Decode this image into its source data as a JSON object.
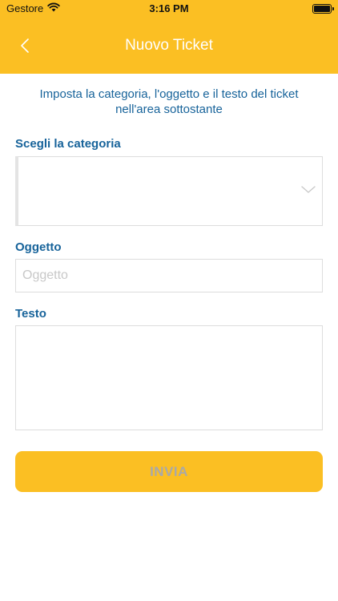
{
  "status_bar": {
    "carrier": "Gestore",
    "time": "3:16 PM"
  },
  "nav": {
    "title": "Nuovo Ticket",
    "back_icon": "chevron-left-icon"
  },
  "intro_text": "Imposta la categoria, l'oggetto e il testo del ticket nell'area sottostante",
  "form": {
    "category_label": "Scegli la categoria",
    "category_value": "",
    "subject_label": "Oggetto",
    "subject_value": "",
    "subject_placeholder": "Oggetto",
    "body_label": "Testo",
    "body_value": "",
    "submit_label": "INVIA"
  },
  "colors": {
    "brand": "#FBBF23",
    "label": "#17639A",
    "disabled_text": "#A9A9A9"
  }
}
